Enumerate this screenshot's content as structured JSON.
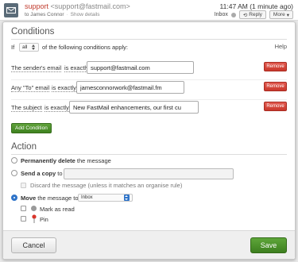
{
  "mail": {
    "from_name": "support",
    "from_address": "<support@fastmail.com>",
    "to": "to James Connor",
    "show_details": "Show details",
    "time": "11:47 AM (1 minute ago)",
    "folder": "Inbox",
    "reply_label": "Reply",
    "more_label": "More"
  },
  "conditions": {
    "title": "Conditions",
    "if_label": "If",
    "match_value": "all",
    "match_suffix": "of the following conditions apply:",
    "help": "Help",
    "rows": [
      {
        "field": "The sender's email",
        "operator": "is exactly",
        "value": "support@fastmail.com"
      },
      {
        "field": "Any \"To\" email",
        "operator": "is exactly",
        "value": "jamesconnorwork@fastmail.fm"
      },
      {
        "field": "The subject",
        "operator": "is exactly",
        "value": "New FastMail enhancements, our first cu"
      }
    ],
    "remove_label": "Remove",
    "add_label": "Add Condition"
  },
  "action": {
    "title": "Action",
    "delete_bold": "Permanently delete",
    "delete_rest": " the message",
    "copy_bold": "Send a copy",
    "copy_rest": " to",
    "discard_label": "Discard the message (unless it matches an organise rule)",
    "move_bold": "Move",
    "move_rest": " the message to",
    "move_folder": "Inbox",
    "mark_read": "Mark as read",
    "pin": "Pin",
    "selected": "move"
  },
  "footer": {
    "cancel": "Cancel",
    "save": "Save"
  },
  "colors": {
    "remove": "#d0453a",
    "save": "#4a8f2a",
    "radio_selected": "#2f74c9",
    "sender_name": "#c0392b"
  }
}
